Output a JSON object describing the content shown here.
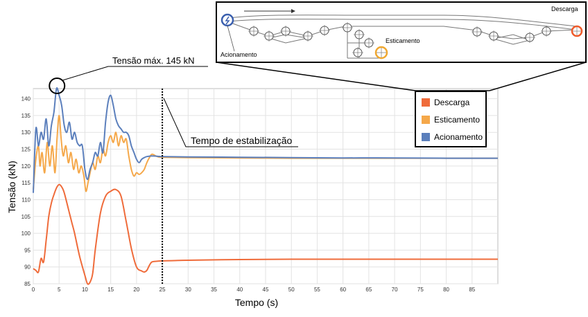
{
  "chart_data": {
    "type": "line",
    "xlabel": "Tempo (s)",
    "ylabel": "Tensão (kN)",
    "xlim": [
      0,
      90
    ],
    "ylim": [
      85,
      143
    ],
    "x_ticks": [
      0,
      5,
      10,
      15,
      20,
      25,
      30,
      35,
      40,
      45,
      50,
      55,
      60,
      65,
      70,
      75,
      80,
      85
    ],
    "y_ticks": [
      85,
      90,
      95,
      100,
      105,
      110,
      115,
      120,
      125,
      130,
      135,
      140
    ],
    "grid": true,
    "legend_position": "top-right",
    "series": [
      {
        "name": "Descarga",
        "color": "#ef6b3a",
        "x": [
          0,
          0.5,
          1,
          1.5,
          2,
          2.5,
          3,
          3.5,
          4,
          4.5,
          5,
          5.5,
          6,
          7,
          7.5,
          8,
          9,
          10,
          10.5,
          11,
          11.5,
          12,
          13,
          14,
          15,
          16,
          17,
          18,
          19,
          20,
          21,
          21.5,
          22,
          22.5,
          23,
          24,
          25,
          30,
          40,
          50,
          60,
          70,
          80,
          90
        ],
        "values": [
          89.5,
          89,
          88.5,
          92.5,
          91.5,
          98,
          105,
          109,
          111.5,
          113.5,
          114.5,
          113.8,
          112,
          106,
          103,
          100,
          93,
          87.5,
          85,
          85.5,
          88,
          95,
          106,
          111,
          112.5,
          113,
          111,
          103.5,
          95.5,
          90,
          88.8,
          88.5,
          89,
          90.5,
          91.5,
          91.7,
          91.8,
          92,
          92.2,
          92.3,
          92.3,
          92.3,
          92.3,
          92.3
        ]
      },
      {
        "name": "Esticamento",
        "color": "#f5a84a",
        "x": [
          0,
          0.5,
          1,
          1.3,
          1.7,
          2.2,
          2.7,
          3.2,
          3.7,
          4.2,
          4.6,
          5,
          5.4,
          5.8,
          6.3,
          6.8,
          7.3,
          7.8,
          8.3,
          8.8,
          9.3,
          9.8,
          10.2,
          10.6,
          11,
          11.5,
          12,
          12.5,
          13,
          13.5,
          14,
          14.5,
          15,
          15.5,
          16,
          16.5,
          17,
          17.5,
          18,
          18.5,
          19,
          19.5,
          20,
          20.5,
          21,
          21.5,
          22,
          22.5,
          23,
          24,
          25,
          30,
          40,
          50,
          60,
          70,
          80,
          90
        ],
        "values": [
          113,
          122,
          126,
          120,
          124,
          118,
          127,
          120,
          126,
          118,
          128,
          135,
          128,
          123,
          126,
          121,
          124,
          119,
          122,
          118,
          120,
          117,
          112.5,
          115,
          118,
          121,
          119,
          123,
          121,
          125,
          123,
          127,
          129,
          127,
          130,
          126,
          129,
          127,
          128,
          123,
          119,
          117,
          118,
          117.5,
          118,
          119,
          121,
          122.5,
          123.5,
          122.8,
          122.6,
          122.5,
          122.4,
          122.3,
          122.3,
          122.3,
          122.3,
          122.3
        ]
      },
      {
        "name": "Acionamento",
        "color": "#5b7fbc",
        "x": [
          0,
          0.5,
          1,
          1.5,
          2,
          2.5,
          3,
          3.5,
          4,
          4.5,
          5,
          5.5,
          6,
          6.5,
          7,
          7.5,
          8,
          8.5,
          9,
          9.5,
          10,
          10.5,
          11,
          11.5,
          12,
          12.5,
          13,
          13.5,
          14,
          14.5,
          15,
          15.5,
          16,
          16.5,
          17,
          17.5,
          18,
          18.5,
          19,
          19.5,
          20,
          20.5,
          21,
          21.5,
          22,
          23,
          24,
          25,
          30,
          40,
          50,
          60,
          70,
          80,
          90
        ],
        "values": [
          112,
          131,
          126,
          130,
          128,
          134,
          126,
          132,
          136,
          143,
          141,
          138,
          132,
          130,
          133,
          128,
          130,
          127,
          126,
          126,
          119,
          116,
          119,
          121,
          124,
          123,
          127,
          124,
          133,
          139,
          141,
          138,
          134,
          132,
          131,
          130,
          130,
          129,
          126,
          124,
          122,
          121,
          122,
          122.5,
          122.8,
          123,
          122.9,
          122.8,
          122.7,
          122.6,
          122.5,
          122.4,
          122.4,
          122.3,
          122.3
        ]
      }
    ],
    "annotations": {
      "max_label": "Tensão máx. 145 kN",
      "stabilization_label": "Tempo de estabilização",
      "stabilization_x": 25,
      "max_x": 4.6,
      "max_y": 143
    }
  },
  "diagram": {
    "discharge_label": "Descarga",
    "tension_label": "Esticamento",
    "drive_label": "Acionamento",
    "drive_color": "#3a5fae",
    "tension_color": "#f0a830",
    "discharge_color": "#ef5a2a"
  }
}
